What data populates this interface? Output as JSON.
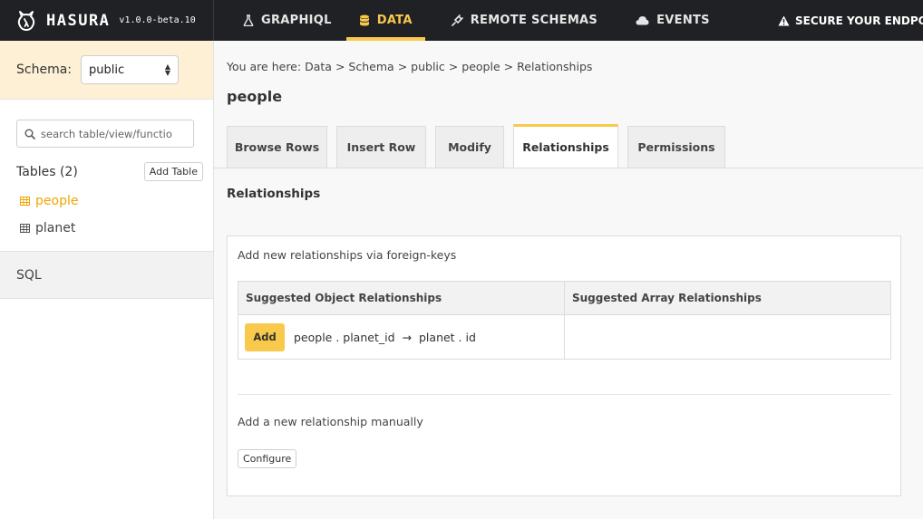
{
  "brand": {
    "name": "HASURA",
    "version": "v1.0.0-beta.10",
    "logo_icon": "hasura-logo-icon"
  },
  "nav": {
    "items": [
      {
        "label": "GRAPHIQL",
        "icon": "flask-icon"
      },
      {
        "label": "DATA",
        "icon": "database-icon",
        "active": true
      },
      {
        "label": "REMOTE SCHEMAS",
        "icon": "plug-icon"
      },
      {
        "label": "EVENTS",
        "icon": "cloud-icon"
      }
    ],
    "secure_label": "SECURE YOUR ENDPOIN",
    "secure_icon": "warning-icon"
  },
  "sidebar": {
    "schema_label": "Schema:",
    "schema_value": "public",
    "search_placeholder": "search table/view/functio",
    "tables_title": "Tables (2)",
    "add_table_label": "Add Table",
    "tables": [
      {
        "label": "people",
        "active": true
      },
      {
        "label": "planet",
        "active": false
      }
    ],
    "sql_label": "SQL"
  },
  "main": {
    "breadcrumb": {
      "prefix": "You are here:",
      "items": [
        "Data",
        "Schema",
        "public",
        "people",
        "Relationships"
      ],
      "separator": ">"
    },
    "page_title": "people",
    "tabs": [
      {
        "label": "Browse Rows"
      },
      {
        "label": "Insert Row"
      },
      {
        "label": "Modify"
      },
      {
        "label": "Relationships",
        "active": true
      },
      {
        "label": "Permissions"
      }
    ],
    "section_title": "Relationships",
    "fk_label": "Add new relationships via foreign-keys",
    "table": {
      "headers": [
        "Suggested Object Relationships",
        "Suggested Array Relationships"
      ],
      "object_row": {
        "add_label": "Add",
        "from": "people . planet_id",
        "arrow": "→",
        "to": "planet . id"
      }
    },
    "manual_label": "Add a new relationship manually",
    "configure_label": "Configure"
  },
  "colors": {
    "accent": "#f8c94b",
    "nav_bg": "#202124",
    "schema_bg": "#fdf0d4",
    "active_table": "#f0a400"
  }
}
